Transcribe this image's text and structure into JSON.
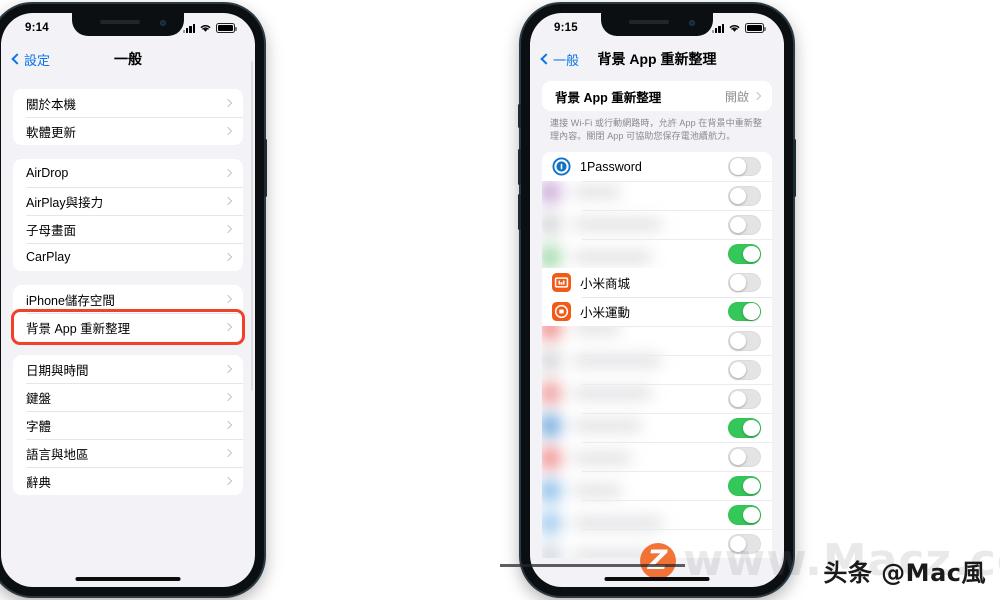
{
  "meta": {
    "watermark_main": "头条 @Mac風",
    "watermark_ghost": "www.Macz.com",
    "watermark_badge": "Z"
  },
  "left_phone": {
    "status": {
      "time": "9:14"
    },
    "nav": {
      "back_label": "設定",
      "title": "一般"
    },
    "groups": [
      {
        "rows": [
          {
            "label": "關於本機",
            "value": ""
          },
          {
            "label": "軟體更新",
            "value": ""
          }
        ]
      },
      {
        "rows": [
          {
            "label": "AirDrop",
            "value": ""
          },
          {
            "label": "AirPlay與接力",
            "value": ""
          },
          {
            "label": "子母畫面",
            "value": ""
          },
          {
            "label": "CarPlay",
            "value": ""
          }
        ]
      },
      {
        "rows": [
          {
            "label": "iPhone儲存空間",
            "value": ""
          },
          {
            "label": "背景 App 重新整理",
            "value": "",
            "highlighted": true
          }
        ]
      },
      {
        "rows": [
          {
            "label": "日期與時間",
            "value": ""
          },
          {
            "label": "鍵盤",
            "value": ""
          },
          {
            "label": "字體",
            "value": ""
          },
          {
            "label": "語言與地區",
            "value": ""
          },
          {
            "label": "辭典",
            "value": ""
          }
        ]
      }
    ]
  },
  "right_phone": {
    "status": {
      "time": "9:15"
    },
    "nav": {
      "back_label": "一般",
      "title": "背景 App 重新整理"
    },
    "master": {
      "label": "背景 App 重新整理",
      "value": "開啟",
      "note": "連接 Wi-Fi 或行動網路時，允許 App 在背景中重新整理內容。關閉 App 可協助您保存電池續航力。"
    },
    "apps": [
      {
        "name": "1Password",
        "icon": "1password-icon",
        "icon_color": "#ffffff",
        "on": false,
        "blurred": false
      },
      {
        "name": "",
        "icon": "blurred-app-icon",
        "icon_color": "#c9a8d8",
        "on": false,
        "blurred": true
      },
      {
        "name": "",
        "icon": "blurred-app-icon",
        "icon_color": "#d6d6da",
        "on": false,
        "blurred": true
      },
      {
        "name": "",
        "icon": "blurred-app-icon",
        "icon_color": "#9fd9a8",
        "on": true,
        "blurred": true
      },
      {
        "name": "小米商城",
        "icon": "mi-store-icon",
        "icon_color": "#f25b17",
        "on": false,
        "blurred": false
      },
      {
        "name": "小米運動",
        "icon": "mi-fit-icon",
        "icon_color": "#f25b17",
        "on": true,
        "blurred": false
      },
      {
        "name": "",
        "icon": "blurred-app-icon",
        "icon_color": "#f08a8a",
        "on": false,
        "blurred": true
      },
      {
        "name": "",
        "icon": "blurred-app-icon",
        "icon_color": "#d6d6da",
        "on": false,
        "blurred": true
      },
      {
        "name": "",
        "icon": "blurred-app-icon",
        "icon_color": "#ef9a9a",
        "on": false,
        "blurred": true
      },
      {
        "name": "",
        "icon": "blurred-app-icon",
        "icon_color": "#6fa8dc",
        "on": true,
        "blurred": true
      },
      {
        "name": "",
        "icon": "blurred-app-icon",
        "icon_color": "#ef8f8f",
        "on": false,
        "blurred": true
      },
      {
        "name": "",
        "icon": "blurred-app-icon",
        "icon_color": "#8bbde8",
        "on": true,
        "blurred": true
      },
      {
        "name": "",
        "icon": "blurred-app-icon",
        "icon_color": "#9ec9ee",
        "on": true,
        "blurred": true
      },
      {
        "name": "",
        "icon": "blurred-app-icon",
        "icon_color": "#cfd8e3",
        "on": false,
        "blurred": true
      }
    ]
  },
  "colors": {
    "accent_blue": "#0a74e8",
    "toggle_on": "#35c759",
    "toggle_off": "#e4e4e6",
    "highlight_red": "#f0422a",
    "page_bg": "#f2f2f7"
  }
}
